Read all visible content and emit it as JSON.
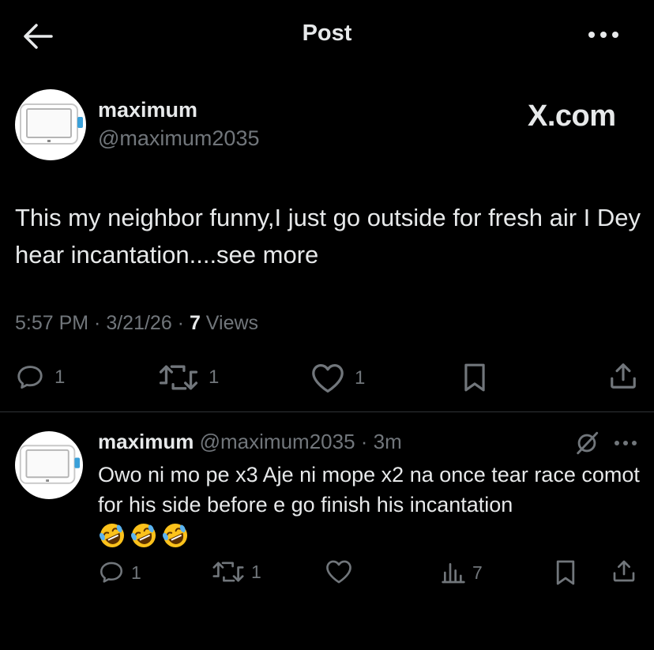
{
  "header": {
    "title": "Post"
  },
  "tweet": {
    "author_name": "maximum",
    "author_handle": "@maximum2035",
    "source_badge": "X.com",
    "text": "This my neighbor funny,I just go outside for fresh air I Dey hear incantation....see more",
    "time": "5:57 PM · 3/21/26 · ",
    "views_count": "7",
    "views_label": " Views",
    "actions": {
      "replies": "1",
      "reposts": "1",
      "likes": "1"
    }
  },
  "reply": {
    "author_name": "maximum",
    "author_handle": "@maximum2035 · 3m",
    "text": "Owo ni mo pe x3 Aje ni mope x2 na once tear race comot for his side before e go finish his incantation",
    "emoji_names": [
      "rofl-emoji",
      "rofl-emoji",
      "rofl-emoji"
    ],
    "actions": {
      "replies": "1",
      "reposts": "1",
      "views": "7"
    }
  },
  "colors": {
    "background": "#000000",
    "text": "#e7e9ea",
    "muted": "#71767b",
    "divider": "#2f3336"
  }
}
